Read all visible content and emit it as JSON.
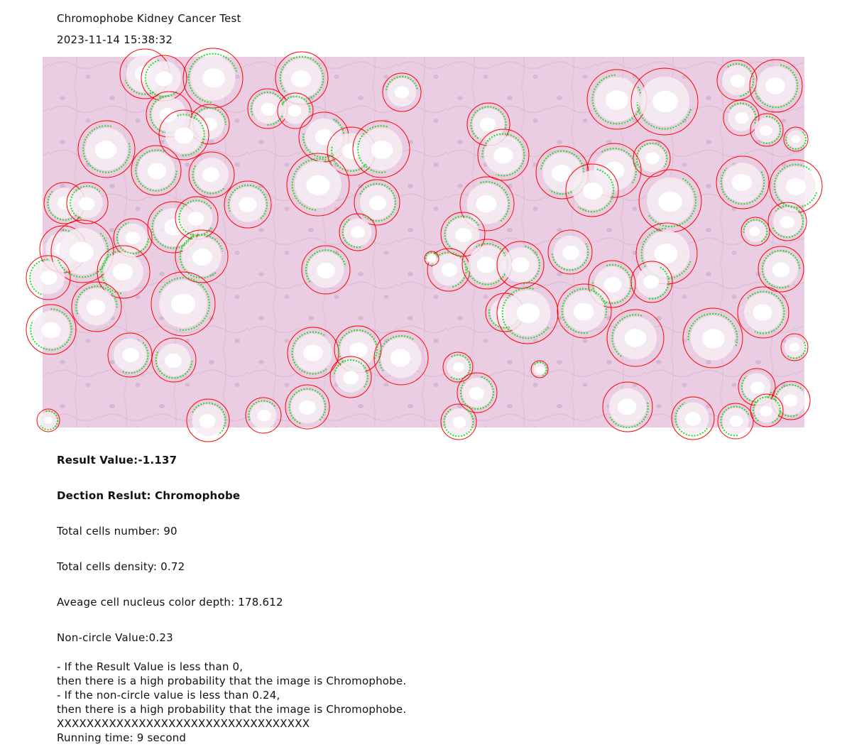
{
  "header": {
    "title": "Chromophobe Kidney Cancer Test",
    "timestamp": "2023-11-14 15:38:32"
  },
  "image": {
    "description_label": "",
    "tissue_color": "#e7c9e1",
    "detection_circle_color": "#ff0000",
    "contour_color": "#22dd22"
  },
  "results": {
    "result_value": "Result Value:-1.137",
    "detection_result": "Dection Reslut: Chromophobe",
    "total_cells": "Total cells number: 90",
    "density": "Total cells density: 0.72",
    "color_depth": "Aveage cell nucleus color depth: 178.612",
    "non_circle": "Non-circle Value:0.23"
  },
  "notes": [
    "- If the Result Value is less than 0,",
    "then there is a high probability that the image is Chromophobe.",
    "- If the non-circle value is less than 0.24,",
    "then there is a high probability that the image is Chromophobe.",
    "XXXXXXXXXXXXXXXXXXXXXXXXXXXXXXXXXX",
    "Running time: 9 second"
  ]
}
